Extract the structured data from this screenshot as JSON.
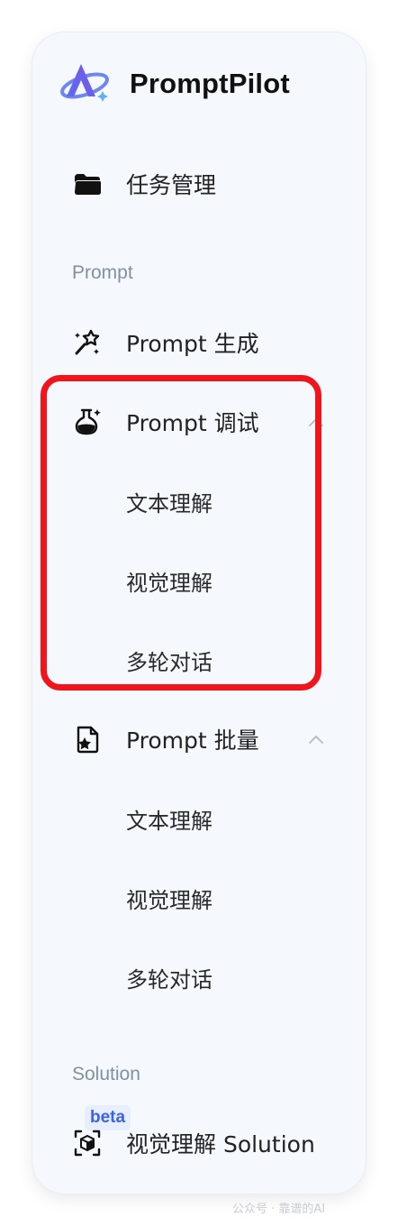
{
  "brand": {
    "name": "PromptPilot"
  },
  "nav": {
    "task": {
      "label": "任务管理"
    },
    "section_prompt": "Prompt",
    "generate": {
      "label": "Prompt 生成"
    },
    "debug": {
      "label": "Prompt 调试",
      "children": [
        "文本理解",
        "视觉理解",
        "多轮对话"
      ]
    },
    "batch": {
      "label": "Prompt 批量",
      "children": [
        "文本理解",
        "视觉理解",
        "多轮对话"
      ]
    },
    "section_solution": "Solution",
    "solution": {
      "label": "视觉理解 Solution",
      "badge": "beta"
    }
  },
  "watermark": "公众号 · 靠谱的AI"
}
